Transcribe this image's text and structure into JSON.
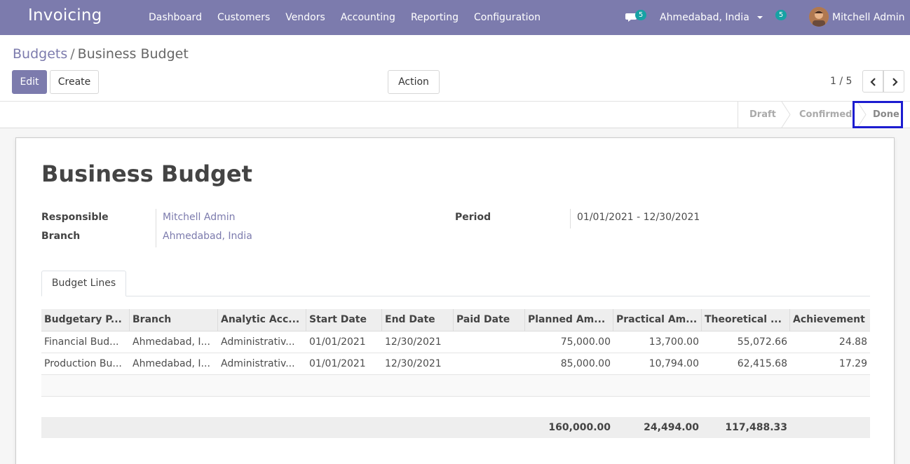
{
  "app": {
    "title": "Invoicing"
  },
  "nav": {
    "items": [
      "Dashboard",
      "Customers",
      "Vendors",
      "Accounting",
      "Reporting",
      "Configuration"
    ],
    "messages_count": "5",
    "company": "Ahmedabad, India",
    "activities_count": "5",
    "user": "Mitchell Admin"
  },
  "breadcrumb": {
    "parent": "Budgets",
    "separator": "/",
    "current": "Business Budget"
  },
  "buttons": {
    "edit": "Edit",
    "create": "Create",
    "action": "Action"
  },
  "pager": {
    "value": "1 / 5"
  },
  "status": {
    "stages": [
      "Draft",
      "Confirmed",
      "Done"
    ],
    "active": "Done"
  },
  "record": {
    "title": "Business Budget",
    "responsible_label": "Responsible",
    "responsible": "Mitchell Admin",
    "branch_label": "Branch",
    "branch": "Ahmedabad, India",
    "period_label": "Period",
    "period": "01/01/2021 - 12/30/2021"
  },
  "tabs": [
    "Budget Lines"
  ],
  "table": {
    "headers": [
      "Budgetary P...",
      "Branch",
      "Analytic Acc...",
      "Start Date",
      "End Date",
      "Paid Date",
      "Planned Am...",
      "Practical Am...",
      "Theoretical ...",
      "Achievement"
    ],
    "rows": [
      [
        "Financial Bud...",
        "Ahmedabad, I...",
        "Administrativ...",
        "01/01/2021",
        "12/30/2021",
        "",
        "75,000.00",
        "13,700.00",
        "55,072.66",
        "24.88"
      ],
      [
        "Production Bu...",
        "Ahmedabad, I...",
        "Administrativ...",
        "01/01/2021",
        "12/30/2021",
        "",
        "85,000.00",
        "10,794.00",
        "62,415.68",
        "17.29"
      ]
    ],
    "totals": {
      "planned": "160,000.00",
      "practical": "24,494.00",
      "theoretical": "117,488.33"
    }
  },
  "colors": {
    "brand": "#7c7bad",
    "badge": "#17a2a4",
    "highlight_outline": "#1c1cd0"
  }
}
